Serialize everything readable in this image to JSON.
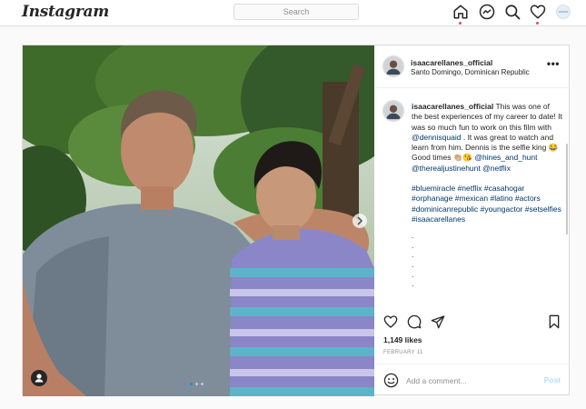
{
  "nav": {
    "logo": "Instagram",
    "search_placeholder": "Search",
    "icons": [
      "home-icon",
      "messenger-icon",
      "explore-icon",
      "activity-heart-icon",
      "profile-avatar"
    ]
  },
  "post": {
    "username": "isaacarellanes_official",
    "location": "Santo Domingo, Dominican Republic",
    "more": "•••",
    "caption": {
      "username": "isaacarellanes_official",
      "text1": " This was one of the best experiences of my career to date! It was so much fun to work on this film with ",
      "mention1": "@dennisquaid",
      "text2": " . It was great to watch and learn from him. Dennis is the selfie king 😂 Good times 👏🏼😘 ",
      "mention2": "@hines_and_hunt",
      "mention3": "@therealjustinehunt",
      "mention4": "@netflix",
      "hashtags": "#bluemiracle #netflix #casahogar #orphanage #mexican #latino #actors #dominicanrepublic #youngactor #setselfies #isaacarellanes",
      "dots": [
        ".",
        ".",
        ".",
        ".",
        ".",
        "."
      ]
    },
    "likes": "1,149 likes",
    "date": "FEBRUARY 11",
    "comment_placeholder": "Add a comment...",
    "post_label": "Post",
    "carousel": {
      "count": 3,
      "active_index": 0
    }
  },
  "colors": {
    "link": "#00376b",
    "notification": "#ed4956",
    "post_disabled": "#b2dffc",
    "carousel_active": "#0095f6"
  }
}
